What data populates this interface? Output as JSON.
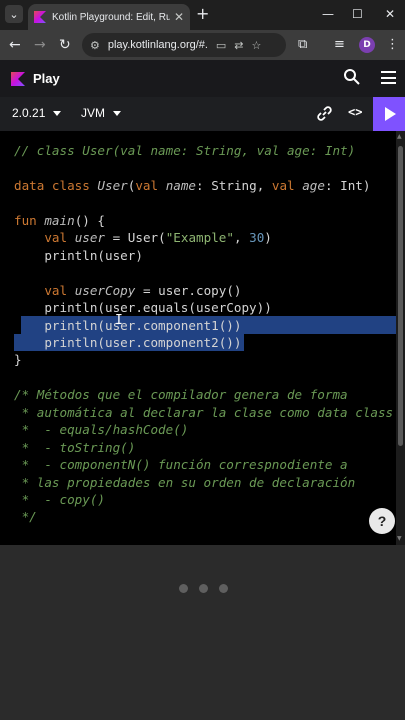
{
  "browser": {
    "tab_title": "Kotlin Playground: Edit, Run, Sh",
    "url": "play.kotlinlang.org/#...",
    "profile_initial": "D",
    "icons": [
      "tab-search-icon",
      "new-tab-icon",
      "minimize-icon",
      "maximize-icon",
      "close-icon",
      "back-icon",
      "forward-icon",
      "reload-icon",
      "site-info-icon",
      "cast-icon",
      "translate-icon",
      "bookmark-star-icon",
      "extensions-icon",
      "media-icon"
    ]
  },
  "playground": {
    "title": "Play",
    "version": "2.0.21",
    "target": "JVM",
    "accent_color": "#7f52ff"
  },
  "editor": {
    "lines": [
      {
        "tokens": [
          {
            "c": "c-comment",
            "t": "// class User(val name: String, val age: Int)"
          }
        ]
      },
      {
        "tokens": []
      },
      {
        "tokens": [
          {
            "c": "c-kw",
            "t": "data class "
          },
          {
            "c": "c-fn-def",
            "t": "User"
          },
          {
            "c": "c-plain",
            "t": "("
          },
          {
            "c": "c-kw",
            "t": "val "
          },
          {
            "c": "c-var",
            "t": "name"
          },
          {
            "c": "c-plain",
            "t": ": String, "
          },
          {
            "c": "c-kw",
            "t": "val "
          },
          {
            "c": "c-var",
            "t": "age"
          },
          {
            "c": "c-plain",
            "t": ": Int)"
          }
        ]
      },
      {
        "tokens": []
      },
      {
        "tokens": [
          {
            "c": "c-kw",
            "t": "fun "
          },
          {
            "c": "c-fn-def",
            "t": "main"
          },
          {
            "c": "c-plain",
            "t": "() {"
          }
        ]
      },
      {
        "tokens": [
          {
            "c": "c-plain",
            "t": "    "
          },
          {
            "c": "c-kw",
            "t": "val "
          },
          {
            "c": "c-var",
            "t": "user"
          },
          {
            "c": "c-plain",
            "t": " = User("
          },
          {
            "c": "c-str",
            "t": "\"Example\""
          },
          {
            "c": "c-plain",
            "t": ", "
          },
          {
            "c": "c-num",
            "t": "30"
          },
          {
            "c": "c-plain",
            "t": ")"
          }
        ]
      },
      {
        "tokens": [
          {
            "c": "c-plain",
            "t": "    println(user)"
          }
        ]
      },
      {
        "tokens": []
      },
      {
        "tokens": [
          {
            "c": "c-plain",
            "t": "    "
          },
          {
            "c": "c-kw",
            "t": "val "
          },
          {
            "c": "c-var",
            "t": "userCopy"
          },
          {
            "c": "c-plain",
            "t": " = user.copy()"
          }
        ]
      },
      {
        "tokens": [
          {
            "c": "c-plain",
            "t": "    println(user.equals(userCopy))"
          }
        ]
      },
      {
        "tokens": [
          {
            "c": "c-plain",
            "t": "    println(user.component1())"
          }
        ]
      },
      {
        "tokens": [
          {
            "c": "c-plain",
            "t": "    println(user.component2())"
          }
        ]
      },
      {
        "tokens": [
          {
            "c": "c-plain",
            "t": "}"
          }
        ]
      },
      {
        "tokens": []
      },
      {
        "tokens": [
          {
            "c": "c-comment",
            "t": "/* Métodos que el compilador genera de forma"
          }
        ]
      },
      {
        "tokens": [
          {
            "c": "c-comment",
            "t": " * automática al declarar la clase como data class"
          }
        ]
      },
      {
        "tokens": [
          {
            "c": "c-comment",
            "t": " *  - equals/hashCode()"
          }
        ]
      },
      {
        "tokens": [
          {
            "c": "c-comment",
            "t": " *  - toString()"
          }
        ]
      },
      {
        "tokens": [
          {
            "c": "c-comment",
            "t": " *  - componentN() función correspnodiente a"
          }
        ]
      },
      {
        "tokens": [
          {
            "c": "c-comment",
            "t": " * las propiedades en su orden de declaración"
          }
        ]
      },
      {
        "tokens": [
          {
            "c": "c-comment",
            "t": " *  - copy()"
          }
        ]
      },
      {
        "tokens": [
          {
            "c": "c-comment",
            "t": " */"
          }
        ]
      }
    ],
    "help_label": "?"
  }
}
